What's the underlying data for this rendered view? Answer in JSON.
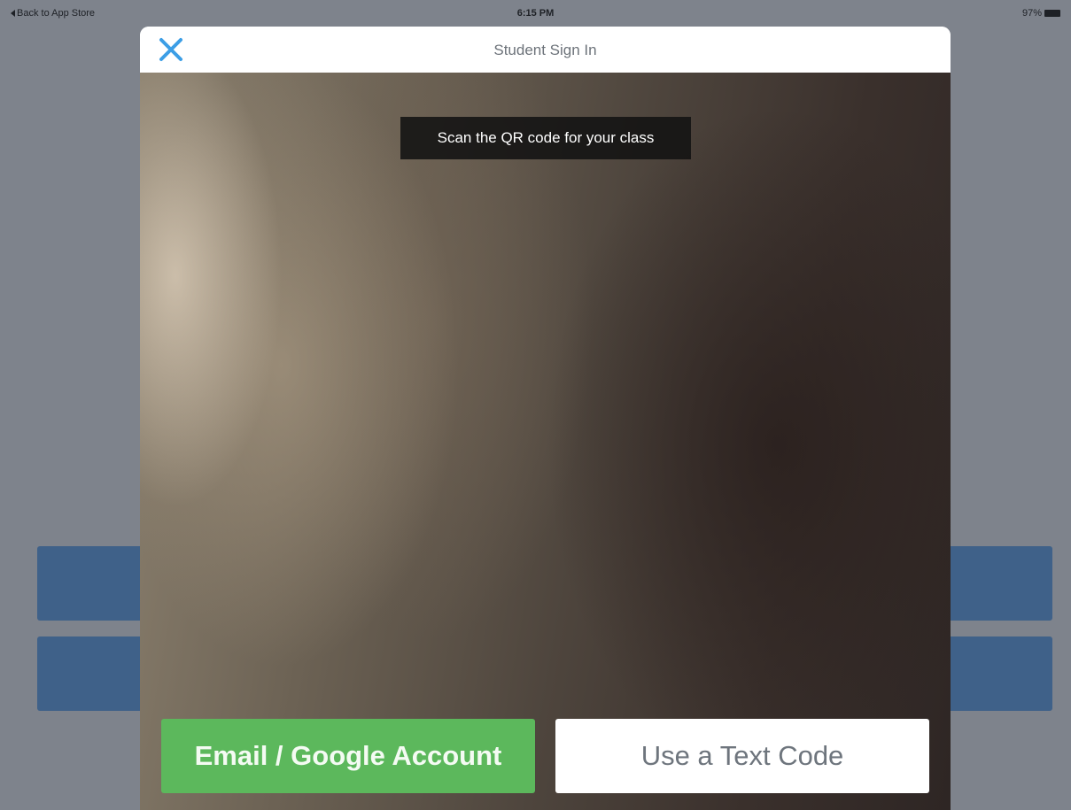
{
  "status_bar": {
    "back_label": "Back to App Store",
    "time": "6:15 PM",
    "battery": "97%"
  },
  "modal": {
    "title": "Student Sign In",
    "close_icon": "close-x-icon",
    "scan_hint": "Scan the QR code for your class",
    "email_button": "Email / Google Account",
    "text_code_button": "Use a Text Code"
  },
  "colors": {
    "accent_blue": "#3c9ee6",
    "email_green": "#5cb85c",
    "background_button_blue": "#3f6189",
    "overlay_gray": "#7e838c"
  }
}
